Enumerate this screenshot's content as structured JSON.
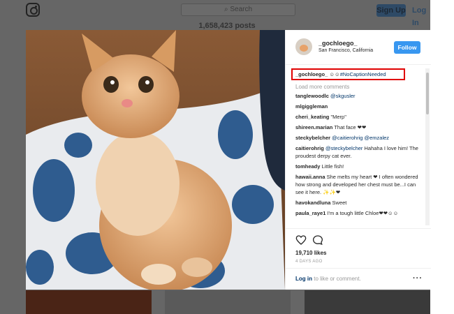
{
  "background": {
    "search_placeholder": "Search",
    "signup_label": "Sign Up",
    "login_label": "Log In",
    "posts_count": "1,658,423 posts"
  },
  "post": {
    "username": "_gochloego_",
    "location": "San Francisco, California",
    "follow_label": "Follow",
    "caption_user": "_gochloego_",
    "caption_text": "☺☺",
    "caption_tag": "#NoCaptionNeeded",
    "load_more": "Load more comments",
    "likes": "19,710 likes",
    "time_ago": "4 DAYS AGO",
    "login_link": "Log in",
    "login_suffix": " to like or comment."
  },
  "comments": [
    {
      "user": "tanglewoodlc",
      "text": "",
      "mention": "@skgusler"
    },
    {
      "user": "mlgiggleman",
      "text": "",
      "mention": ""
    },
    {
      "user": "cheri_keating",
      "text": "\"Merp\"",
      "mention": ""
    },
    {
      "user": "shireen.marian",
      "text": "That face ❤❤",
      "mention": ""
    },
    {
      "user": "steckybelcher",
      "text": "",
      "mention": "@caitierohrig @emzalez"
    },
    {
      "user": "caitierohrig",
      "text": "Hahaha I love him! The proudest derpy cat ever.",
      "mention": "@steckybelcher",
      "mention_first": true
    },
    {
      "user": "tomheady",
      "text": "Little fish!",
      "mention": ""
    },
    {
      "user": "hawaii.anna",
      "text": "She melts my heart ❤ I often wondered how strong and developed her chest must be...I can see it here. ✨✨❤",
      "mention": ""
    },
    {
      "user": "havokandluna",
      "text": "Sweet",
      "mention": ""
    },
    {
      "user": "paula_raye1",
      "text": "I'm a tough little Chloe❤❤☺☺",
      "mention": ""
    }
  ],
  "icons": {
    "instagram_logo": "instagram-logo-icon",
    "heart": "heart-icon",
    "comment": "comment-bubble-icon",
    "more": "more-options-icon"
  },
  "colors": {
    "follow_button": "#3897f0",
    "link": "#003569",
    "highlight_box": "#e00000"
  }
}
